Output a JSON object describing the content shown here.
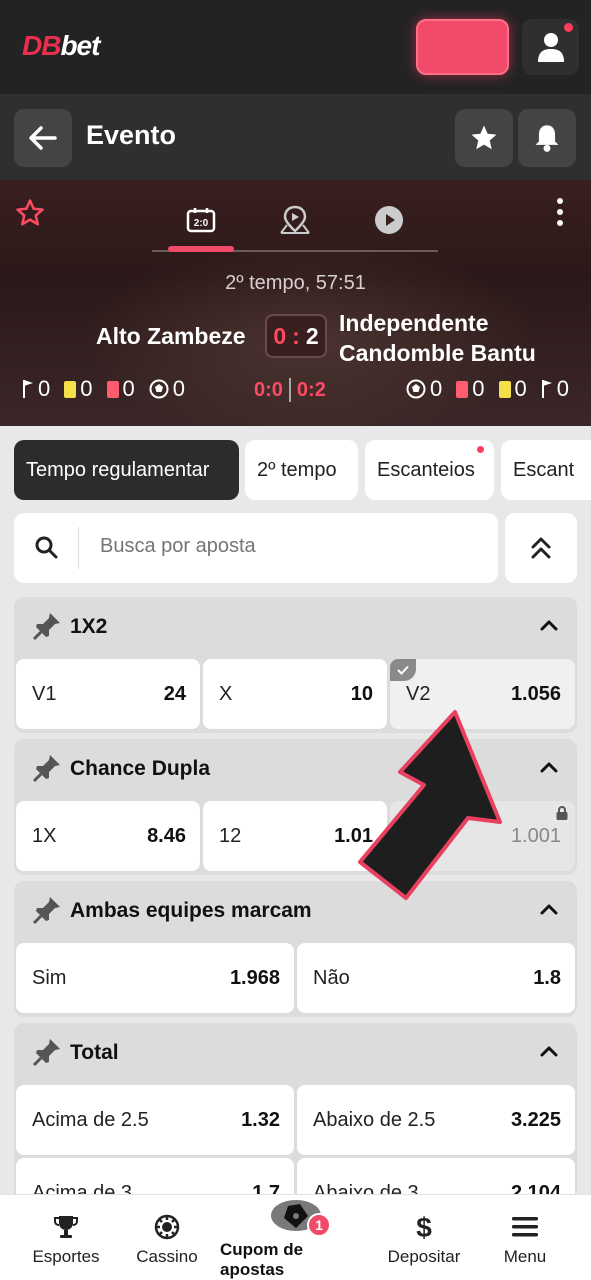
{
  "app": {
    "logo_db": "DB",
    "logo_bet": "bet"
  },
  "header": {
    "title": "Evento"
  },
  "match": {
    "time": "2º tempo, 57:51",
    "team_home": "Alto Zambeze",
    "team_away": "Independente Candomble Bantu",
    "score_home": "0",
    "score_sep": ":",
    "score_away": "2",
    "half1": "0:0",
    "half2": "0:2",
    "stats_home": {
      "corners": "0",
      "yellow": "0",
      "red": "0",
      "goals": "0"
    },
    "stats_away": {
      "goals": "0",
      "red": "0",
      "yellow": "0",
      "corners": "0"
    }
  },
  "chips": [
    {
      "label": "Tempo regulamentar",
      "active": true
    },
    {
      "label": "2º tempo"
    },
    {
      "label": "Escanteios",
      "dot": true
    },
    {
      "label": "Escant"
    }
  ],
  "search": {
    "placeholder": "Busca por aposta"
  },
  "markets": [
    {
      "title": "1X2",
      "odds": [
        {
          "label": "V1",
          "value": "24"
        },
        {
          "label": "X",
          "value": "10"
        },
        {
          "label": "V2",
          "value": "1.056",
          "selected": true
        }
      ]
    },
    {
      "title": "Chance Dupla",
      "odds": [
        {
          "label": "1X",
          "value": "8.46"
        },
        {
          "label": "12",
          "value": "1.01"
        },
        {
          "label": "",
          "value": "1.001",
          "locked": true
        }
      ]
    },
    {
      "title": "Ambas equipes marcam",
      "odds": [
        {
          "label": "Sim",
          "value": "1.968"
        },
        {
          "label": "Não",
          "value": "1.8"
        }
      ]
    },
    {
      "title": "Total",
      "odds": [
        {
          "label": "Acima de 2.5",
          "value": "1.32"
        },
        {
          "label": "Abaixo de 2.5",
          "value": "3.225"
        },
        {
          "label": "Acima de 3",
          "value": "1.7"
        },
        {
          "label": "Abaixo de 3",
          "value": "2.104"
        }
      ]
    }
  ],
  "bottom_nav": {
    "sports": "Esportes",
    "casino": "Cassino",
    "coupon": "Cupom de apostas",
    "coupon_count": "1",
    "deposit": "Depositar",
    "menu": "Menu"
  },
  "colors": {
    "accent": "#f24a6a",
    "dark": "#232323",
    "header": "#2f2f2f"
  }
}
